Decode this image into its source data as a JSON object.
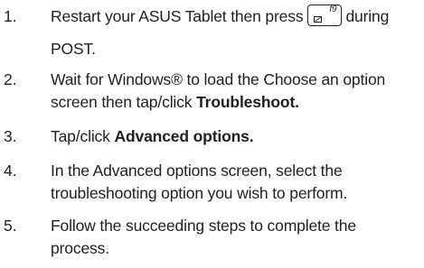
{
  "steps": [
    {
      "number": "1.",
      "before_key": "Restart your ASUS Tablet then press",
      "key_label": "f9",
      "after_key": "during",
      "line2": "POST."
    },
    {
      "number": "2.",
      "line1": "Wait for Windows® to load the Choose an option",
      "line2_plain": "screen then tap/click ",
      "line2_bold": "Troubleshoot."
    },
    {
      "number": "3.",
      "plain": "Tap/click ",
      "bold": "Advanced options."
    },
    {
      "number": "4.",
      "line1": "In the Advanced options screen, select the",
      "line2": "troubleshooting option you wish to perform."
    },
    {
      "number": "5.",
      "line1": "Follow the succeeding steps to complete the",
      "line2": "process."
    }
  ]
}
